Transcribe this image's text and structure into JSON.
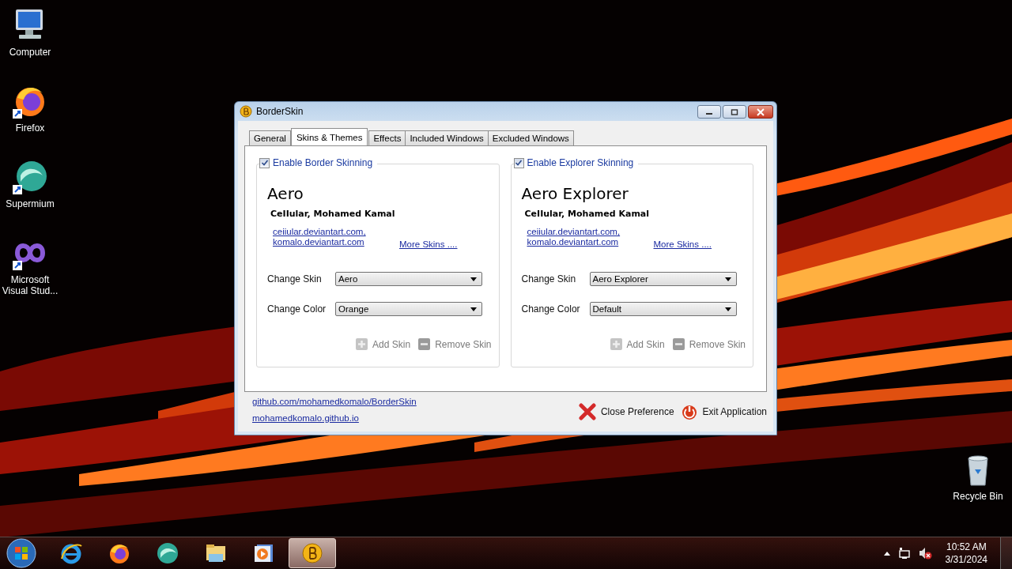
{
  "desktop_icons": [
    {
      "kind": "computer",
      "label": "Computer"
    },
    {
      "kind": "firefox",
      "label": "Firefox"
    },
    {
      "kind": "supermium",
      "label": "Supermium"
    },
    {
      "kind": "visualstudio",
      "label": "Microsoft Visual Stud..."
    }
  ],
  "recycle_bin": {
    "label": "Recycle Bin"
  },
  "window": {
    "title": "BorderSkin",
    "tabs": [
      {
        "label": "General",
        "selected": false
      },
      {
        "label": "Skins & Themes",
        "selected": true
      },
      {
        "label": "Effects",
        "selected": false
      },
      {
        "label": "Included Windows",
        "selected": false
      },
      {
        "label": "Excluded Windows",
        "selected": false
      }
    ],
    "panels": [
      {
        "enable_label": "Enable Border Skinning",
        "checked": true,
        "skin_name": "Aero",
        "authors": "CeIIular, Mohamed Kamal",
        "links": [
          "ceiiular.deviantart.com,",
          "komalo.deviantart.com"
        ],
        "more_link": "More Skins ....",
        "skin_label": "Change Skin",
        "skin_value": "Aero",
        "color_label": "Change Color",
        "color_value": "Orange",
        "add_button": "Add Skin",
        "remove_button": "Remove Skin"
      },
      {
        "enable_label": "Enable Explorer Skinning",
        "checked": true,
        "skin_name": "Aero Explorer",
        "authors": "CeIIular, Mohamed Kamal",
        "links": [
          "ceiiular.deviantart.com,",
          "komalo.deviantart.com"
        ],
        "more_link": "More Skins ....",
        "skin_label": "Change Skin",
        "skin_value": "Aero Explorer",
        "color_label": "Change Color",
        "color_value": "Default",
        "add_button": "Add Skin",
        "remove_button": "Remove Skin"
      }
    ],
    "footer_links": [
      "github.com/mohamedkomalo/BorderSkin",
      "mohamedkomalo.github.io"
    ],
    "close_button": "Close Preference",
    "exit_button": "Exit Application"
  },
  "taskbar": {
    "apps": [
      {
        "kind": "ie",
        "active": false
      },
      {
        "kind": "firefox",
        "active": false
      },
      {
        "kind": "supermium",
        "active": false
      },
      {
        "kind": "explorer",
        "active": false
      },
      {
        "kind": "media",
        "active": false
      },
      {
        "kind": "borderskin",
        "active": true
      }
    ],
    "time": "10:52 AM",
    "date": "3/31/2024"
  }
}
